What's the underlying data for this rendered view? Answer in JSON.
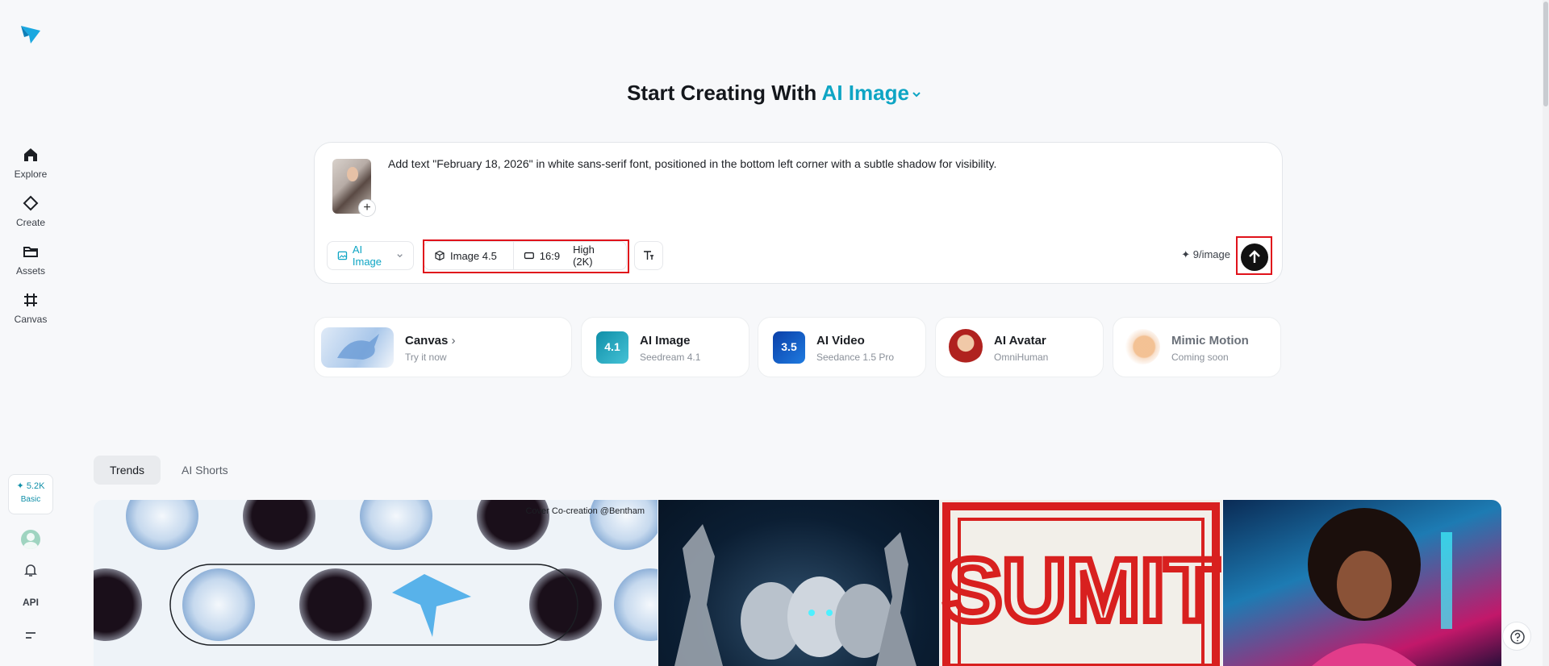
{
  "sidebar": {
    "items": [
      {
        "label": "Explore"
      },
      {
        "label": "Create"
      },
      {
        "label": "Assets"
      },
      {
        "label": "Canvas"
      }
    ],
    "credits": {
      "value": "5.2K",
      "plan": "Basic"
    },
    "api_label": "API"
  },
  "hero": {
    "title_prefix": "Start Creating With",
    "title_accent": "AI Image"
  },
  "prompt": {
    "text": "Add text \"February 18, 2026\" in white sans-serif font, positioned in the bottom left corner with a subtle shadow for visibility.",
    "mode_label": "AI Image",
    "model_label": "Image 4.5",
    "ratio_label": "16:9",
    "quality_label": "High (2K)",
    "cost_label": "9/image"
  },
  "features": [
    {
      "title": "Canvas",
      "sub": "Try it now"
    },
    {
      "title": "AI Image",
      "sub": "Seedream 4.1",
      "badge": "4.1"
    },
    {
      "title": "AI Video",
      "sub": "Seedance 1.5 Pro",
      "badge": "3.5"
    },
    {
      "title": "AI Avatar",
      "sub": "OmniHuman"
    },
    {
      "title": "Mimic Motion",
      "sub": "Coming soon"
    }
  ],
  "tabs": [
    {
      "label": "Trends"
    },
    {
      "label": "AI Shorts"
    }
  ],
  "gallery": {
    "cover_tag": "Cover Co-creation @Bentham",
    "poster_text": "SUMIT"
  },
  "colors": {
    "accent": "#0ea5c4",
    "highlight": "#e0121b"
  }
}
